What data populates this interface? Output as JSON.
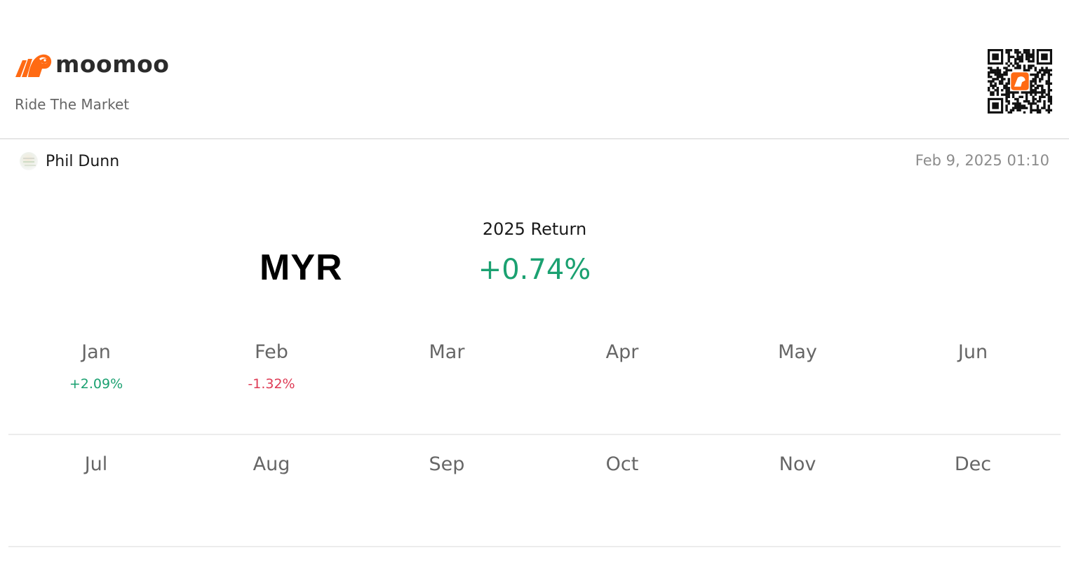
{
  "brand": {
    "name": "moomoo",
    "tagline": "Ride The Market",
    "accent_color": "#ff6a13",
    "logo_icon": "bull-icon",
    "qr_icon": "qr-code-icon"
  },
  "author": {
    "name": "Phil Dunn",
    "avatar_icon": "avatar-icon"
  },
  "timestamp": "Feb 9, 2025 01:10",
  "summary": {
    "currency": "MYR",
    "return_label": "2025 Return",
    "return_value": "+0.74%",
    "return_color": "#1ba171"
  },
  "colors": {
    "positive": "#1ba171",
    "negative": "#de3b55"
  },
  "months": [
    {
      "label": "Jan",
      "value": "+2.09%",
      "sign": "pos"
    },
    {
      "label": "Feb",
      "value": "-1.32%",
      "sign": "neg"
    },
    {
      "label": "Mar",
      "value": "",
      "sign": ""
    },
    {
      "label": "Apr",
      "value": "",
      "sign": ""
    },
    {
      "label": "May",
      "value": "",
      "sign": ""
    },
    {
      "label": "Jun",
      "value": "",
      "sign": ""
    },
    {
      "label": "Jul",
      "value": "",
      "sign": ""
    },
    {
      "label": "Aug",
      "value": "",
      "sign": ""
    },
    {
      "label": "Sep",
      "value": "",
      "sign": ""
    },
    {
      "label": "Oct",
      "value": "",
      "sign": ""
    },
    {
      "label": "Nov",
      "value": "",
      "sign": ""
    },
    {
      "label": "Dec",
      "value": "",
      "sign": ""
    }
  ]
}
